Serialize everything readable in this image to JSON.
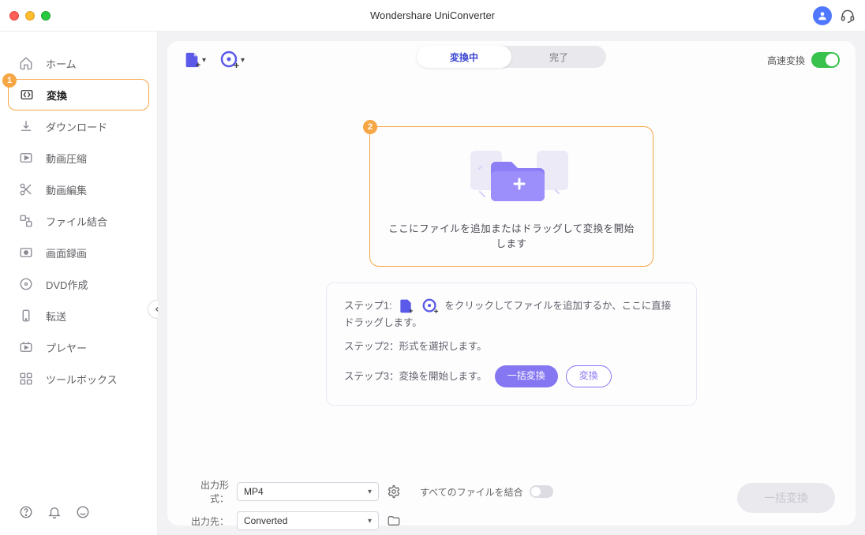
{
  "app_title": "Wondershare UniConverter",
  "sidebar": {
    "items": [
      {
        "label": "ホーム"
      },
      {
        "label": "変換",
        "badge": "1",
        "active": true
      },
      {
        "label": "ダウンロード"
      },
      {
        "label": "動画圧縮"
      },
      {
        "label": "動画編集"
      },
      {
        "label": "ファイル結合"
      },
      {
        "label": "画面録画"
      },
      {
        "label": "DVD作成"
      },
      {
        "label": "転送"
      },
      {
        "label": "プレヤー"
      },
      {
        "label": "ツールボックス"
      }
    ]
  },
  "tabs": {
    "converting": "変換中",
    "done": "完了"
  },
  "high_speed_label": "高速変換",
  "dropzone": {
    "badge": "2",
    "text": "ここにファイルを追加またはドラッグして変換を開始します"
  },
  "steps": {
    "s1_pre": "ステップ1:",
    "s1_post": "をクリックしてファイルを追加するか、ここに直接ドラッグします。",
    "s2": "ステップ2：形式を選択します。",
    "s3": "ステップ3：変換を開始します。",
    "batch_btn": "一括変換",
    "convert_btn": "変換"
  },
  "footer": {
    "format_label": "出力形式：",
    "format_value": "MP4",
    "dest_label": "出力先：",
    "dest_value": "Converted",
    "merge_label": "すべてのファイルを結合",
    "big_btn": "一括変換"
  }
}
